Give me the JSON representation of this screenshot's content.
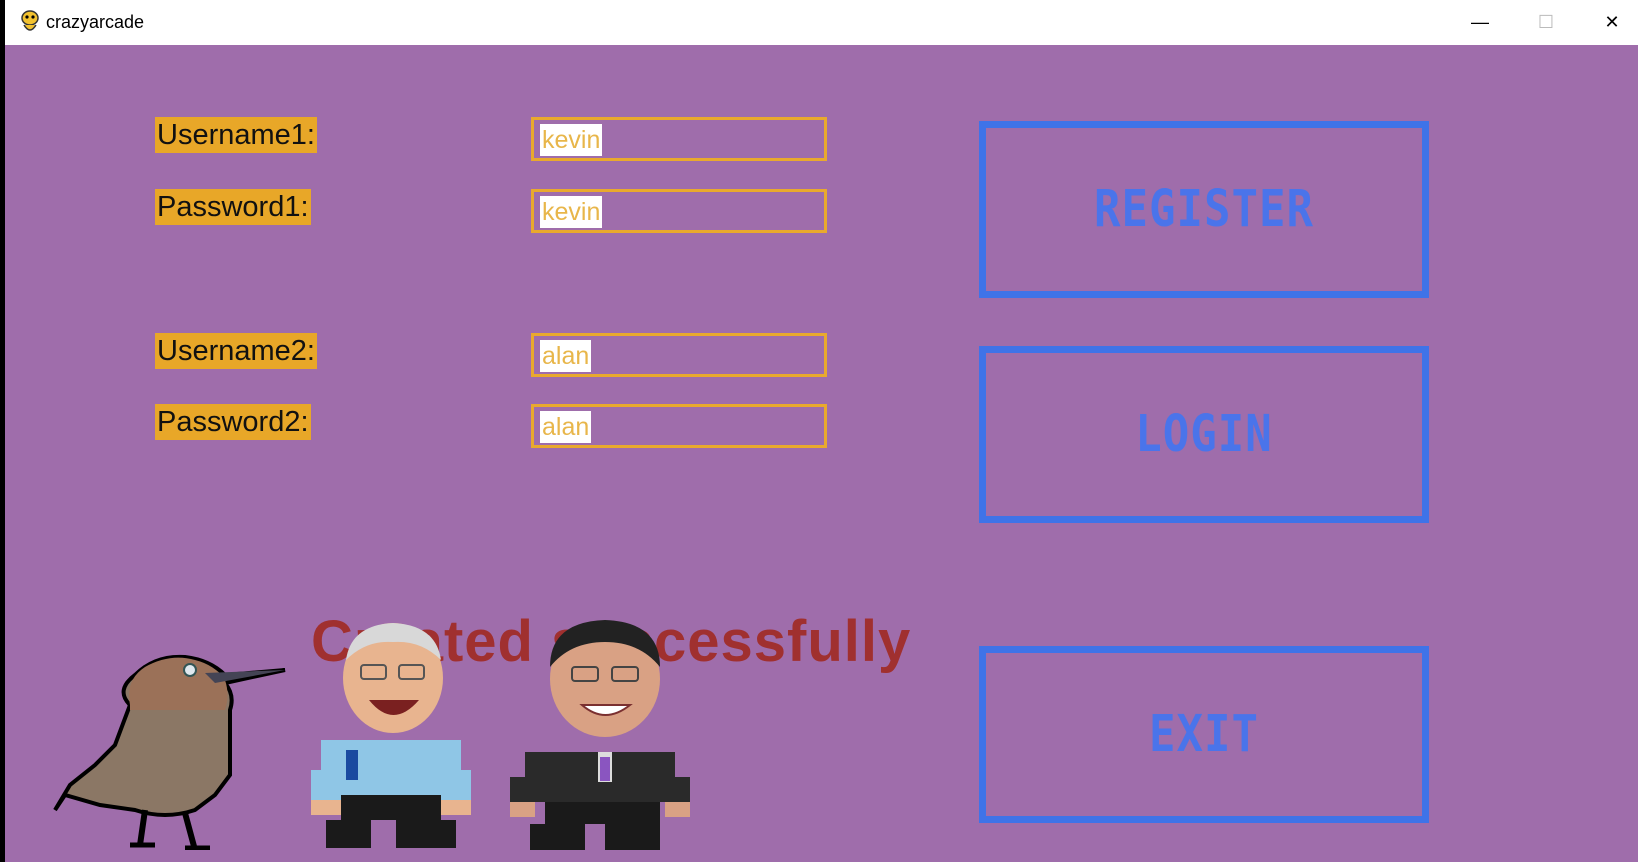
{
  "window": {
    "title": "crazyarcade",
    "controls": {
      "minimize": "—",
      "maximize": "☐",
      "close": "✕"
    }
  },
  "form": {
    "username1_label": "Username1:",
    "password1_label": "Password1:",
    "username2_label": "Username2:",
    "password2_label": "Password2:",
    "username1_value": "kevin",
    "password1_value": "kevin",
    "username2_value": "alan",
    "password2_value": "alan"
  },
  "buttons": {
    "register": "REGISTER",
    "login": "LOGIN",
    "exit": "EXIT"
  },
  "status": "Created successfully",
  "colors": {
    "background": "#9f6dab",
    "label_bg": "#e8a728",
    "field_border": "#e9a92d",
    "button_border": "#3f73e8",
    "status_text": "#a0302f"
  },
  "icons": [
    "pygame-snake-icon",
    "minimize-icon",
    "maximize-icon",
    "close-icon"
  ]
}
